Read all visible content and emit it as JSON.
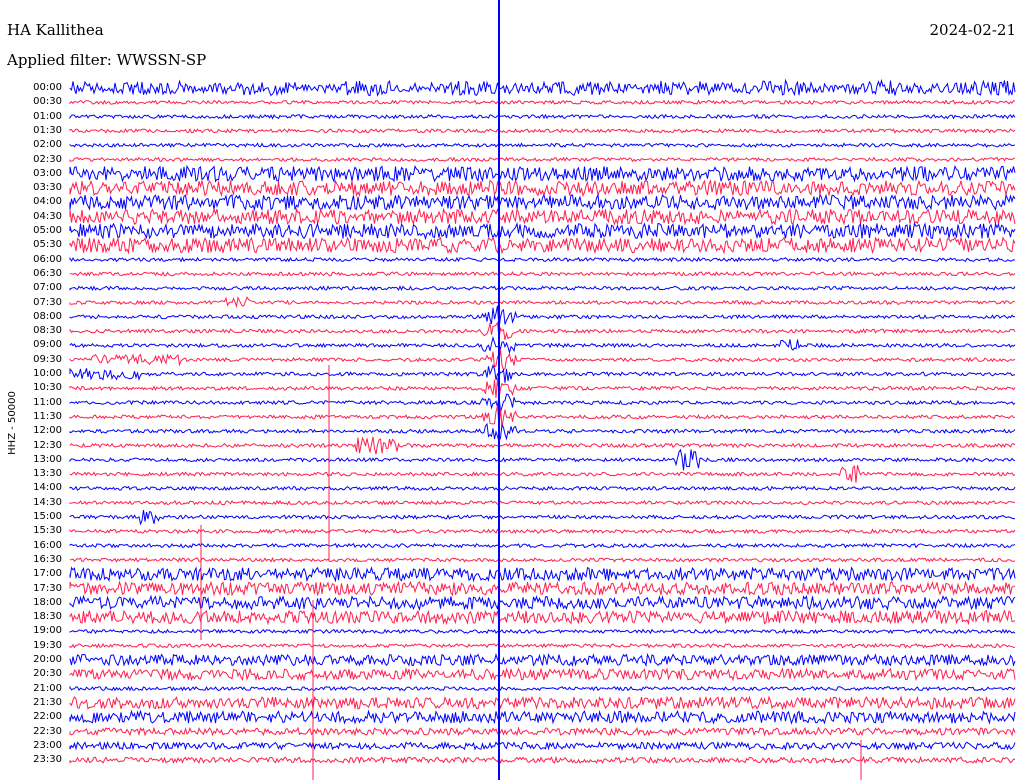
{
  "header": {
    "station": "HA Kallithea",
    "date": "2024-02-21",
    "filter": "Applied filter: WWSSN-SP"
  },
  "axis": {
    "channel_label": "HHZ  -  50000"
  },
  "colors": {
    "trace_a": "#0000ff",
    "trace_b": "#ff1f4f",
    "background": "#ffffff",
    "text": "#000000"
  },
  "traces": {
    "count": 48,
    "first_label": "00:00",
    "last_label": "23:30",
    "labels": [
      "00:00",
      "00:30",
      "01:00",
      "01:30",
      "02:00",
      "02:30",
      "03:00",
      "03:30",
      "04:00",
      "04:30",
      "05:00",
      "05:30",
      "06:00",
      "06:30",
      "07:00",
      "07:30",
      "08:00",
      "08:30",
      "09:00",
      "09:30",
      "10:00",
      "10:30",
      "11:00",
      "11:30",
      "12:00",
      "12:30",
      "13:00",
      "13:30",
      "14:00",
      "14:30",
      "15:00",
      "15:30",
      "16:00",
      "16:30",
      "17:00",
      "17:30",
      "18:00",
      "18:30",
      "19:00",
      "19:30",
      "20:00",
      "20:30",
      "21:00",
      "21:30",
      "22:00",
      "22:30",
      "23:00",
      "23:30"
    ]
  }
}
